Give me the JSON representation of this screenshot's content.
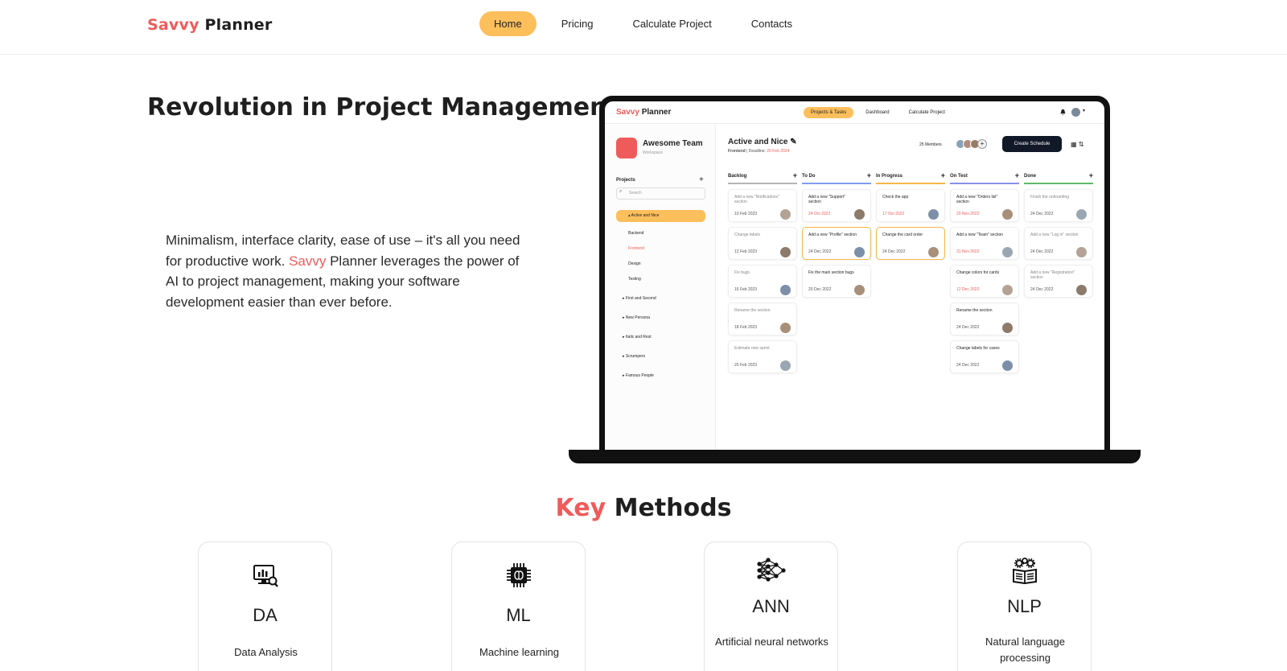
{
  "navbar": {
    "brand_accent": "Savvy",
    "brand_rest": "Planner",
    "items": [
      "Home",
      "Pricing",
      "Calculate Project",
      "Contacts"
    ]
  },
  "hero": {
    "title": "Revolution in Project Management!",
    "text_before": "Minimalism, interface clarity, ease of use – it's all you need for productive work. ",
    "text_accent": "Savvy",
    "text_after": " Planner leverages the power of AI to project management, making your software development easier than ever before."
  },
  "preview": {
    "brand_accent": "Savvy",
    "brand_rest": " Planner",
    "nav": [
      "Projects & Tasks",
      "Dashboard",
      "Calculate Project"
    ],
    "team_name": "Awesome Team",
    "team_sub": "Workspace",
    "projects_label": "Projects",
    "search_placeholder": "Search",
    "active_project": "Active and Nice",
    "sub_items": [
      "Backend",
      "Frontend",
      "Design",
      "Testing"
    ],
    "other_projects": [
      "First and Second",
      "New Persona",
      "Italic and Rest",
      "Scrumpers",
      "Famous People"
    ],
    "board_title": "Active and Nice",
    "board_team": "Frontend",
    "board_deadline_label": "Deadline:",
    "board_deadline": "20 Feb 2024",
    "members": "25 Members",
    "create_button": "Create Schedule",
    "columns": [
      {
        "name": "Backlog",
        "color": "#b5b5b5",
        "cards": [
          {
            "title": "Add a new \"Notifications\" section",
            "date": "10 Feb 2023",
            "muted": true
          },
          {
            "title": "Change labels",
            "date": "12 Feb 2023",
            "muted": true
          },
          {
            "title": "Fix bugs",
            "date": "16 Feb 2023",
            "muted": true
          },
          {
            "title": "Rename the section",
            "date": "18 Feb 2023",
            "muted": true
          },
          {
            "title": "Estimate new sprint",
            "date": "20 Feb 2023",
            "muted": true
          }
        ]
      },
      {
        "name": "To Do",
        "color": "#7e9df0",
        "cards": [
          {
            "title": "Add a new \"Support\" section",
            "date": "24 Oct 2022",
            "red": true
          },
          {
            "title": "Add a new \"Profile\" section",
            "date": "24 Dec 2022",
            "hl": true
          },
          {
            "title": "Fix the main section bugs",
            "date": "20 Dec 2022"
          }
        ]
      },
      {
        "name": "In Progress",
        "color": "#f5b74a",
        "cards": [
          {
            "title": "Check the app",
            "date": "17 Oct 2022",
            "red": true
          },
          {
            "title": "Change the card order",
            "date": "24 Dec 2022",
            "hl": true
          }
        ]
      },
      {
        "name": "On Test",
        "color": "#8a8fe8",
        "cards": [
          {
            "title": "Add a new \"Orders list\" section",
            "date": "20 Nov 2022",
            "red": true
          },
          {
            "title": "Add a new \"Team\" section",
            "date": "31 Nov 2022",
            "red": true
          },
          {
            "title": "Change colors for cards",
            "date": "12 Dec 2022",
            "red": true
          },
          {
            "title": "Rename the section",
            "date": "24 Dec 2022"
          },
          {
            "title": "Change labels for cases",
            "date": "24 Dec 2022"
          }
        ]
      },
      {
        "name": "Done",
        "color": "#5fb86a",
        "cards": [
          {
            "title": "Finish the onboarding",
            "date": "24 Dec 2022",
            "muted": true
          },
          {
            "title": "Add a new \"Log in\" section",
            "date": "24 Dec 2022",
            "muted": true
          },
          {
            "title": "Add a new \"Registration\" section",
            "date": "24 Dec 2022",
            "muted": true
          }
        ]
      }
    ]
  },
  "methods": {
    "title_accent": "Key",
    "title_rest": " Methods",
    "items": [
      {
        "abbr": "DA",
        "desc": "Data Analysis",
        "icon": "data-analysis-icon"
      },
      {
        "abbr": "ML",
        "desc": "Machine learning",
        "icon": "chip-icon"
      },
      {
        "abbr": "ANN",
        "desc": "Artificial neural networks",
        "icon": "neural-network-icon"
      },
      {
        "abbr": "NLP",
        "desc": "Natural language processing",
        "icon": "book-gears-icon"
      }
    ]
  },
  "colors": {
    "accent": "#ef5b5b",
    "highlight": "#fcbf5c",
    "dark": "#111827"
  }
}
